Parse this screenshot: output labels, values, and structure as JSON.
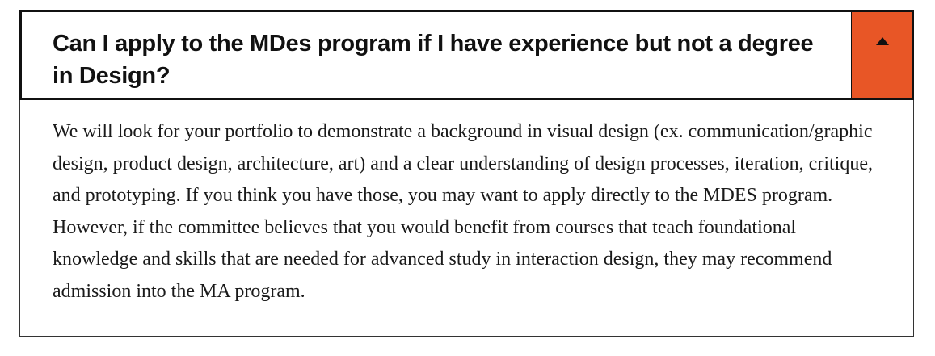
{
  "faq": {
    "question": "Can I apply to the MDes program if I have experience but not a degree in Design?",
    "answer": "We will look for your portfolio to demonstrate a background in visual design (ex. communication/graphic design, product design, architecture, art) and a clear understanding of design processes, iteration, critique, and prototyping. If you think you have those, you may want to apply directly to the MDES program. However, if the committee believes that you would benefit from courses that teach foundational knowledge and skills that are needed for advanced study in interaction design, they may recommend admission into the MA program.",
    "expanded": true,
    "toggle_icon": "caret-up-icon",
    "accent_color": "#e85626"
  }
}
